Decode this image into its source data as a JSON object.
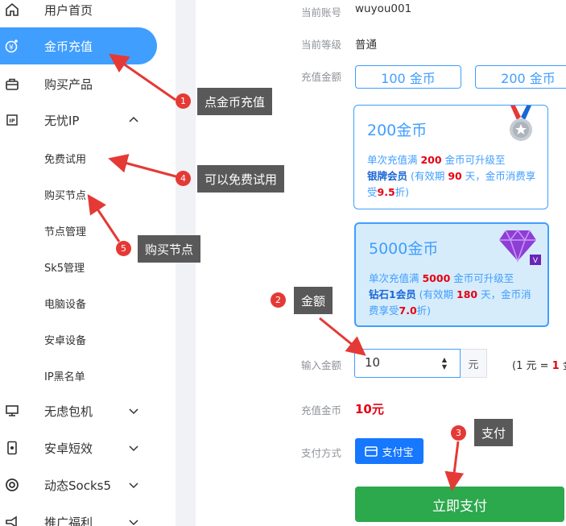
{
  "sidebar": {
    "items": [
      {
        "label": "用户首页",
        "icon": "home-icon"
      },
      {
        "label": "金币充值",
        "icon": "coin-recharge-icon"
      },
      {
        "label": "购买产品",
        "icon": "shopping-bag-icon"
      },
      {
        "label": "无忧IP",
        "icon": "ip-icon"
      },
      {
        "label": "无虑包机",
        "icon": "monitor-icon"
      },
      {
        "label": "安卓短效",
        "icon": "phone-icon"
      },
      {
        "label": "动态Socks5",
        "icon": "socks-icon"
      },
      {
        "label": "推广福利",
        "icon": "promo-icon"
      }
    ],
    "sub_items": [
      "免费试用",
      "购买节点",
      "节点管理",
      "Sk5管理",
      "电脑设备",
      "安卓设备",
      "IP黑名单"
    ]
  },
  "account": {
    "account_label": "当前账号",
    "account_value": "wuyou001",
    "level_label": "当前等级",
    "level_value": "普通",
    "amount_label": "充值金额",
    "amount_options": [
      "100 金币",
      "200 金币"
    ]
  },
  "cards": [
    {
      "title": "200金币",
      "pre1": "单次充值满 ",
      "amount": "200",
      "post1": " 金币可升级至",
      "level": "银牌会员",
      "mid": " (有效期 ",
      "days": "90",
      "post2": " 天，金币消费享受",
      "discount": "9.5",
      "tail": "折)",
      "badge_icon": "silver-medal-icon"
    },
    {
      "title": "5000金币",
      "pre1": "单次充值满 ",
      "amount": "5000",
      "post1": " 金币可升级至",
      "level": "钻石1会员",
      "mid": " (有效期 ",
      "days": "180",
      "post2": " 天，金币消费享受",
      "discount": "7.0",
      "tail": "折)",
      "badge_icon": "diamond-icon"
    }
  ],
  "input": {
    "label": "输入金额",
    "value": "10",
    "unit": "元",
    "rate_prefix": "(1 元 = ",
    "rate_value": "1",
    "rate_suffix": " 金"
  },
  "coins": {
    "label": "充值金币",
    "value": "10元"
  },
  "payment": {
    "label": "支付方式",
    "method": "支付宝"
  },
  "pay_button": "立即支付",
  "annotations": [
    {
      "num": "1",
      "text": "点金币充值"
    },
    {
      "num": "2",
      "text": "金额"
    },
    {
      "num": "3",
      "text": "支付"
    },
    {
      "num": "4",
      "text": "可以免费试用"
    },
    {
      "num": "5",
      "text": "购买节点"
    }
  ],
  "colors": {
    "accent": "#409eff",
    "pay_green": "#2ca84d",
    "alipay_blue": "#1677ff",
    "highlight_red": "#e60012",
    "annotation_red": "#e53935"
  }
}
